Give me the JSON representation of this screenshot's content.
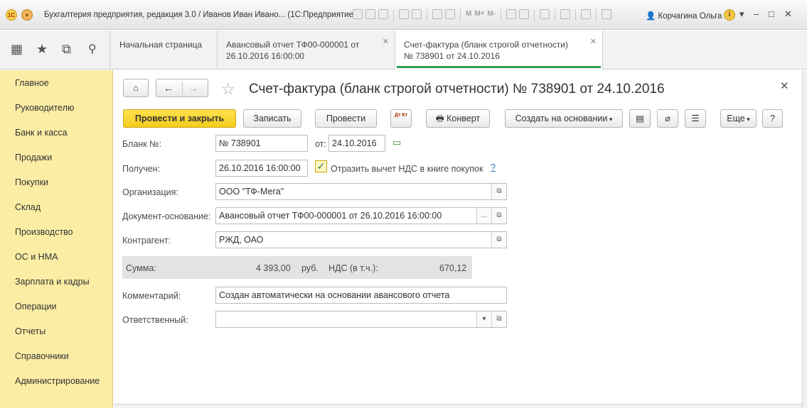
{
  "titlebar": {
    "title": "Бухгалтерия предприятия, редакция 3.0 / Иванов Иван Ивано...  (1С:Предприятие)",
    "user": "Корчагина Ольга",
    "memory_buttons": [
      "M",
      "M+",
      "M-"
    ]
  },
  "tabs": [
    {
      "label_line1": "Начальная страница",
      "label_line2": ""
    },
    {
      "label_line1": "Авансовый отчет ТФ00-000001 от",
      "label_line2": "26.10.2016 16:00:00"
    },
    {
      "label_line1": "Счет-фактура (бланк строгой отчетности)",
      "label_line2": "№ 738901 от 24.10.2016"
    }
  ],
  "sidebar": {
    "items": [
      "Главное",
      "Руководителю",
      "Банк и касса",
      "Продажи",
      "Покупки",
      "Склад",
      "Производство",
      "ОС и НМА",
      "Зарплата и кадры",
      "Операции",
      "Отчеты",
      "Справочники",
      "Администрирование"
    ]
  },
  "document": {
    "title": "Счет-фактура (бланк строгой отчетности) № 738901 от 24.10.2016"
  },
  "toolbar": {
    "post_close": "Провести и закрыть",
    "save": "Записать",
    "post": "Провести",
    "dtkt": "Дт Кт",
    "envelope": "Конверт",
    "create_based": "Создать на основании",
    "more": "Еще",
    "help": "?"
  },
  "form": {
    "blank_label": "Бланк №:",
    "blank_value": "№ 738901",
    "date_from_label": "от:",
    "date_value": "24.10.2016",
    "received_label": "Получен:",
    "received_value": "26.10.2016 16:00:00",
    "vat_checkbox_label": "Отразить вычет НДС в книге покупок",
    "vat_checkbox_checked": true,
    "help_link": "?",
    "org_label": "Организация:",
    "org_value": "ООО \"ТФ-Мега\"",
    "basis_label": "Документ-основание:",
    "basis_value": "Авансовый отчет ТФ00-000001 от 26.10.2016 16:00:00",
    "counterparty_label": "Контрагент:",
    "counterparty_value": "РЖД, ОАО",
    "sum_label": "Сумма:",
    "sum_value": "4 393,00",
    "currency": "руб.",
    "vat_label": "НДС (в т.ч.):",
    "vat_value": "670,12",
    "comment_label": "Комментарий:",
    "comment_value": "Создан автоматически на основании авансового отчета",
    "responsible_label": "Ответственный:",
    "responsible_value": ""
  }
}
